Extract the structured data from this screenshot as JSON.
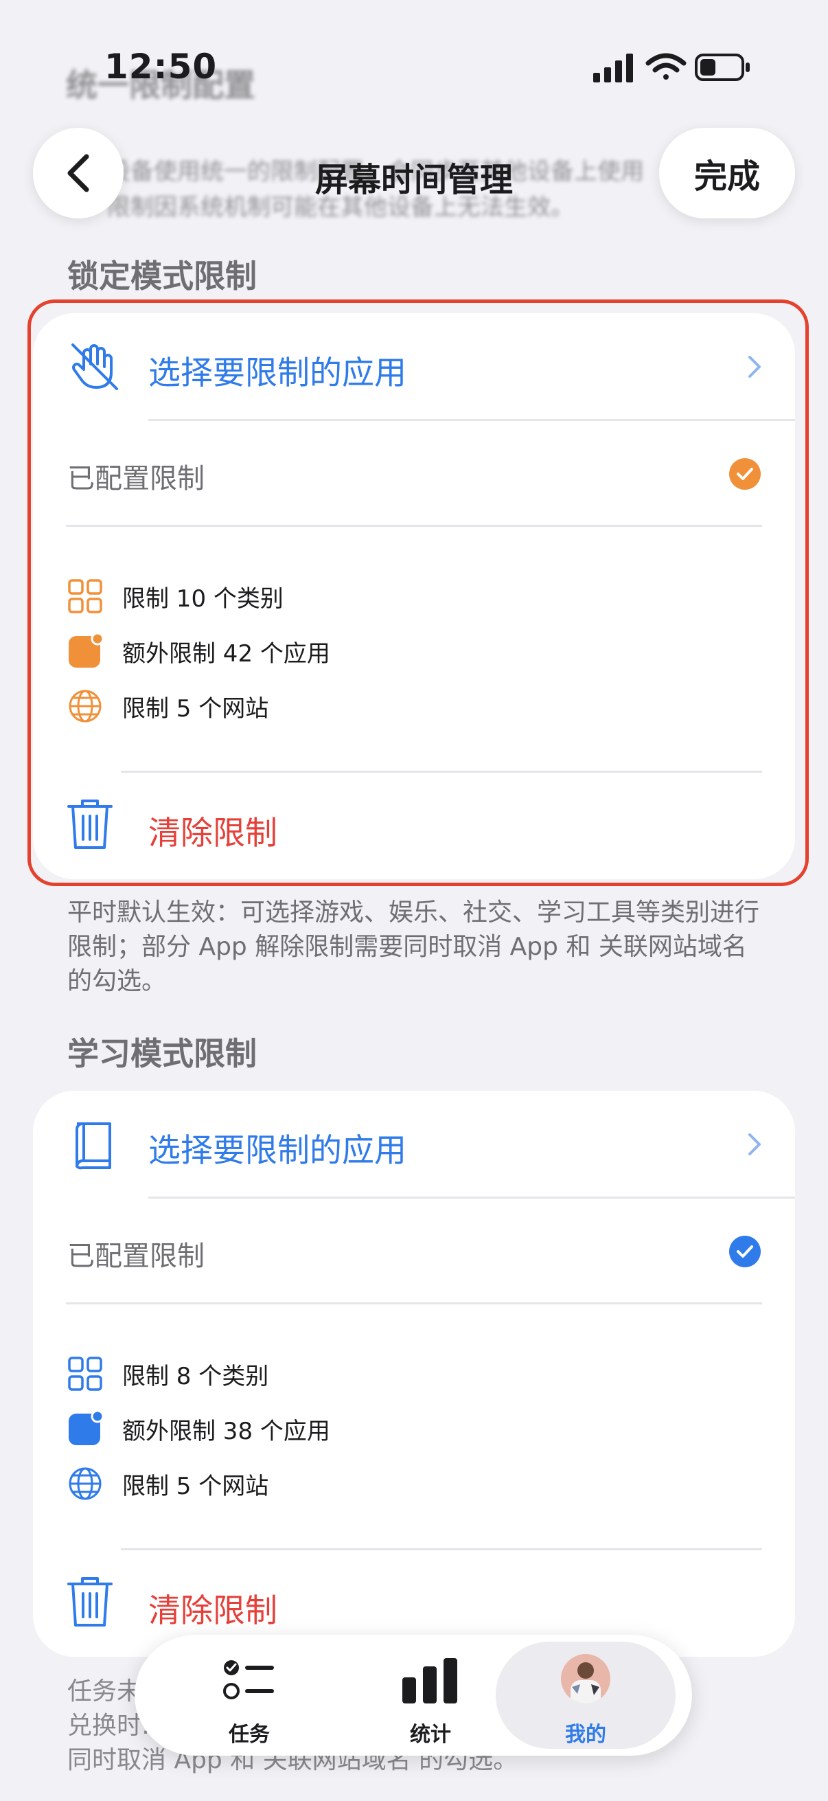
{
  "status_bar": {
    "time": "12:50"
  },
  "nav": {
    "title": "屏幕时间管理",
    "done_label": "完成"
  },
  "background_ghost": {
    "heading": "统一限制配置",
    "line1": "设备使用统一的限制配置，会同步至其他设备上使用",
    "line2": "限制因系统机制可能在其他设备上无法生效。"
  },
  "lock_section": {
    "title": "锁定模式限制",
    "select_apps_label": "选择要限制的应用",
    "configured_label": "已配置限制",
    "accent_color": "#f0913a",
    "stats": [
      {
        "icon": "categories-grid-icon",
        "text": "限制 10 个类别"
      },
      {
        "icon": "app-badge-icon",
        "text": "额外限制 42 个应用"
      },
      {
        "icon": "globe-icon",
        "text": "限制 5 个网站"
      }
    ],
    "clear_label": "清除限制",
    "footnote": "平时默认生效：可选择游戏、娱乐、社交、学习工具等类别进行限制；部分 App 解除限制需要同时取消 App 和 关联网站域名 的勾选。"
  },
  "study_section": {
    "title": "学习模式限制",
    "select_apps_label": "选择要限制的应用",
    "configured_label": "已配置限制",
    "accent_color": "#2f7bea",
    "stats": [
      {
        "icon": "categories-grid-icon",
        "text": "限制 8 个类别"
      },
      {
        "icon": "app-badge-icon",
        "text": "额外限制 38 个应用"
      },
      {
        "icon": "globe-icon",
        "text": "限制 5 个网站"
      }
    ],
    "clear_label": "清除限制",
    "footnote_visible": "任务未完成…\n兑换时…\n同时取消 App 和 关联网站域名 的勾选。"
  },
  "tab_bar": {
    "tabs": [
      {
        "label": "任务",
        "icon": "task-list-icon",
        "active": false
      },
      {
        "label": "统计",
        "icon": "bar-chart-icon",
        "active": false
      },
      {
        "label": "我的",
        "icon": "avatar",
        "active": true
      }
    ]
  },
  "colors": {
    "link_blue": "#2f7bea",
    "destructive_red": "#e5413a",
    "highlight_red": "#e5412f"
  }
}
